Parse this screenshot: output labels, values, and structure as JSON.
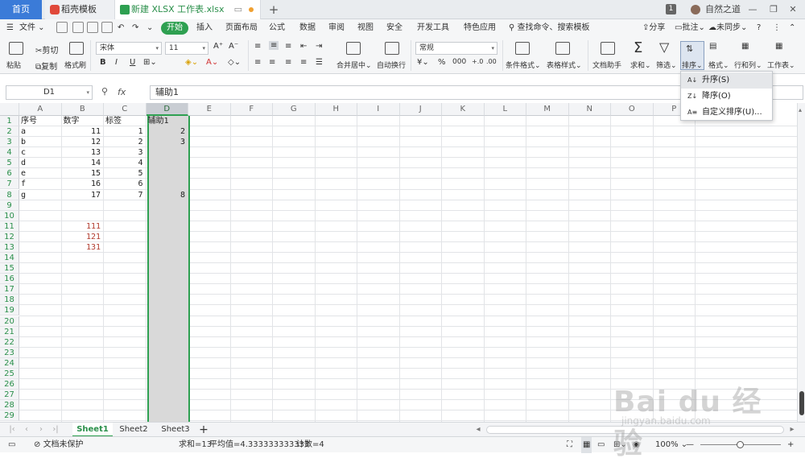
{
  "titlebar": {
    "tab_home": "首页",
    "tab_daoke": "稻壳模板",
    "tab_doc": "新建 XLSX 工作表.xlsx",
    "tab_add": "+",
    "badge": "1",
    "username": "自然之道"
  },
  "menubar": {
    "file": "文件",
    "tabs": [
      "开始",
      "插入",
      "页面布局",
      "公式",
      "数据",
      "审阅",
      "视图",
      "安全",
      "开发工具",
      "特色应用"
    ],
    "search": "查找命令、搜索模板",
    "share": "分享",
    "comment": "批注",
    "sync": "未同步",
    "help": "?"
  },
  "ribbon": {
    "paste": "粘贴",
    "cut": "剪切",
    "copy": "复制",
    "format_painter": "格式刷",
    "font_name": "宋体",
    "font_size": "11",
    "bold": "B",
    "italic": "I",
    "underline": "U",
    "merge_center": "合并居中",
    "auto_wrap": "自动换行",
    "number_format": "常规",
    "cond_format": "条件格式",
    "table_style": "表格样式",
    "doc_assistant": "文档助手",
    "sum": "求和",
    "filter": "筛选",
    "sort": "排序",
    "format": "格式",
    "row_col": "行和列",
    "worksheet": "工作表"
  },
  "formula_bar": {
    "name_box": "D1",
    "fx": "fx",
    "content": "辅助1"
  },
  "sheet": {
    "columns": [
      "A",
      "B",
      "C",
      "D",
      "E",
      "F",
      "G",
      "H",
      "I",
      "J",
      "K",
      "L",
      "M",
      "N",
      "O",
      "P"
    ],
    "rows": [
      "1",
      "2",
      "3",
      "4",
      "5",
      "6",
      "7",
      "8",
      "9",
      "10",
      "11",
      "12",
      "13",
      "14",
      "15",
      "16",
      "17",
      "18",
      "19",
      "20",
      "21",
      "22",
      "23",
      "24",
      "25",
      "26",
      "27",
      "28",
      "29"
    ],
    "headers": {
      "a": "序号",
      "b": "数字",
      "c": "标签",
      "d": "辅助1"
    },
    "col_a": [
      "a",
      "b",
      "c",
      "d",
      "e",
      "f",
      "g"
    ],
    "col_b": [
      "11",
      "12",
      "13",
      "14",
      "15",
      "16",
      "17"
    ],
    "col_c": [
      "1",
      "2",
      "3",
      "4",
      "5",
      "6",
      "7"
    ],
    "col_d": {
      "r2": "2",
      "r3": "3",
      "r8": "8"
    },
    "col_b_extra": [
      "111",
      "121",
      "131"
    ]
  },
  "sort_menu": {
    "ascending": "升序(S)",
    "descending": "降序(O)",
    "custom": "自定义排序(U)..."
  },
  "sheet_tabs": [
    "Sheet1",
    "Sheet2",
    "Sheet3"
  ],
  "status": {
    "protect": "文档未保护",
    "sum": "求和=13",
    "avg": "平均值=4.333333333333",
    "count": "计数=4",
    "zoom": "100%"
  },
  "watermark": {
    "logo": "Bai du 经验",
    "url": "jingyan.baidu.com"
  },
  "colors": {
    "accent": "#2ea051",
    "home_tab": "#3b7bd8",
    "red_text": "#b13b2e"
  }
}
